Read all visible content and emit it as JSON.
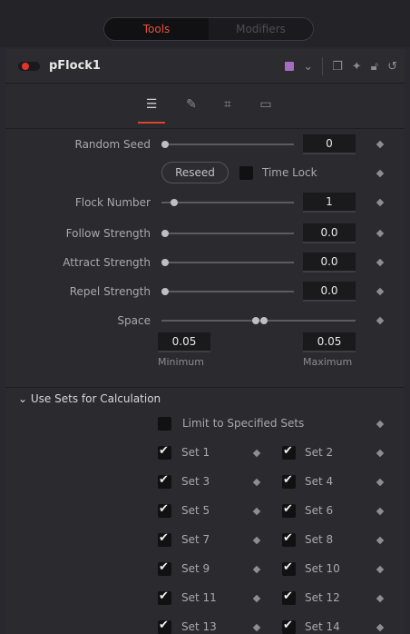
{
  "top_tabs": {
    "tools": "Tools",
    "modifiers": "Modifiers"
  },
  "header": {
    "node_name": "pFlock1",
    "swatch_color": "#a56cc1",
    "icons": [
      "color-swatch-icon",
      "chevron-down-icon",
      "window-icon",
      "pin-icon",
      "lock-icon",
      "reset-icon"
    ]
  },
  "sub_tabs": [
    "controls-tab",
    "style-tab",
    "region-tab",
    "settings-tab"
  ],
  "controls": {
    "random_seed": {
      "label": "Random Seed",
      "value": "0"
    },
    "reseed_label": "Reseed",
    "time_lock_label": "Time Lock",
    "flock_number": {
      "label": "Flock Number",
      "value": "1"
    },
    "follow_strength": {
      "label": "Follow Strength",
      "value": "0.0"
    },
    "attract_strength": {
      "label": "Attract Strength",
      "value": "0.0"
    },
    "repel_strength": {
      "label": "Repel Strength",
      "value": "0.0"
    },
    "space": {
      "label": "Space",
      "min_value": "0.05",
      "max_value": "0.05",
      "min_label": "Minimum",
      "max_label": "Maximum"
    }
  },
  "sets_section": {
    "title": "Use Sets for Calculation",
    "limit_label": "Limit to Specified Sets",
    "sets": [
      {
        "left": "Set 1",
        "right": "Set 2"
      },
      {
        "left": "Set 3",
        "right": "Set 4"
      },
      {
        "left": "Set 5",
        "right": "Set 6"
      },
      {
        "left": "Set 7",
        "right": "Set 8"
      },
      {
        "left": "Set 9",
        "right": "Set 10"
      },
      {
        "left": "Set 11",
        "right": "Set 12"
      },
      {
        "left": "Set 13",
        "right": "Set 14"
      }
    ]
  }
}
